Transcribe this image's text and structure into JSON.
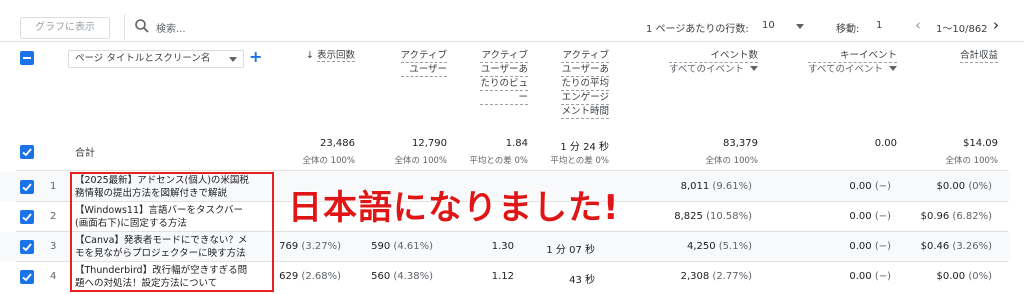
{
  "toolbar": {
    "graph_button": "グラフに表示",
    "search_placeholder": "検索...",
    "rows_per_page_label": "1 ページあたりの行数:",
    "rows_per_page_value": "10",
    "goto_label": "移動:",
    "goto_value": "1",
    "pagination": "1〜10/862"
  },
  "header": {
    "dimension_select": "ページ タイトルとスクリーン名",
    "columns": {
      "views": "表示回数",
      "active_users": [
        "アクティブ",
        "ユーザー"
      ],
      "views_per_user": [
        "アクティブ",
        "ユーザーあ",
        "たりのビュ",
        "ー"
      ],
      "avg_engagement": [
        "アクティブ",
        "ユーザーあ",
        "たりの平均",
        "エンゲージ",
        "メント時間"
      ],
      "event_count": "イベント数",
      "event_count_sub": "すべてのイベント",
      "key_events": "キーイベント",
      "key_events_sub": "すべてのイベント",
      "total_revenue": "合計収益"
    }
  },
  "totals": {
    "label": "合計",
    "views": "23,486",
    "views_sub": "全体の 100%",
    "active_users": "12,790",
    "active_users_sub": "全体の 100%",
    "views_per_user": "1.84",
    "views_per_user_sub": "平均との差 0%",
    "avg_engagement": "1 分 24 秒",
    "avg_engagement_sub": "平均との差 0%",
    "event_count": "83,379",
    "event_count_sub": "全体の 100%",
    "key_events": "0.00",
    "total_revenue": "$14.09",
    "total_revenue_sub": "全体の 100%"
  },
  "rows": [
    {
      "n": "1",
      "title": [
        "【2025最新】アドセンス(個人)の米国税",
        "務情報の提出方法を図解付きで解説"
      ],
      "views": "",
      "views_pct": "",
      "users": "",
      "users_pct": "",
      "vpu": "",
      "eng": "",
      "events": "8,011",
      "events_pct": "(9.61%)",
      "key": "0.00",
      "key_pct": "(−)",
      "rev": "$0.00",
      "rev_pct": "(0%)"
    },
    {
      "n": "2",
      "title": [
        "【Windows11】言語バーをタスクバー",
        "(画面右下)に固定する方法"
      ],
      "views": "",
      "views_pct": "",
      "users": "",
      "users_pct": "",
      "vpu": "",
      "eng": "",
      "events": "8,825",
      "events_pct": "(10.58%)",
      "key": "0.00",
      "key_pct": "(−)",
      "rev": "$0.96",
      "rev_pct": "(6.82%)"
    },
    {
      "n": "3",
      "title": [
        "【Canva】発表者モードにできない？メ",
        "モを見ながらプロジェクターに映す方法"
      ],
      "views": "769",
      "views_pct": "(3.27%)",
      "users": "590",
      "users_pct": "(4.61%)",
      "vpu": "1.30",
      "eng": "1 分 07 秒",
      "events": "4,250",
      "events_pct": "(5.1%)",
      "key": "0.00",
      "key_pct": "(−)",
      "rev": "$0.46",
      "rev_pct": "(3.26%)"
    },
    {
      "n": "4",
      "title": [
        "【Thunderbird】改行幅が空きすぎる問",
        "題への対処法！設定方法について"
      ],
      "views": "629",
      "views_pct": "(2.68%)",
      "users": "560",
      "users_pct": "(4.38%)",
      "vpu": "1.12",
      "eng": "43 秒",
      "events": "2,308",
      "events_pct": "(2.77%)",
      "key": "0.00",
      "key_pct": "(−)",
      "rev": "$0.00",
      "rev_pct": "(0%)"
    }
  ],
  "overlay_text": "日本語になりました!",
  "colors": {
    "accent": "#1a73e8",
    "annotation_red": "#e01616"
  }
}
